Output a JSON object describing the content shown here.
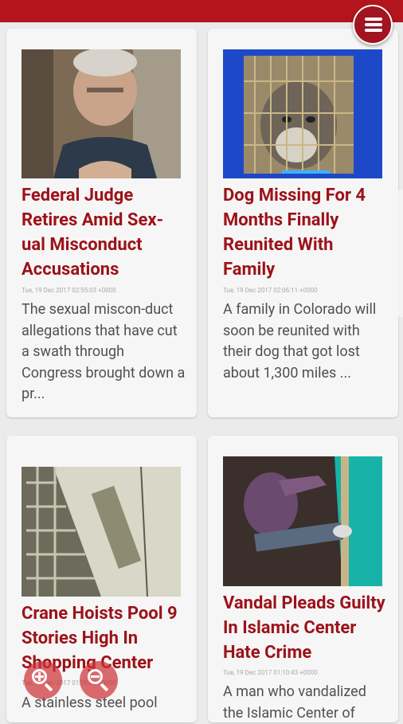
{
  "app": {
    "menu_icon": "hamburger-menu-icon",
    "accent_color": "#b3141d"
  },
  "articles": [
    {
      "title": "Federal Judge Retires Amid Sex-ual Misconduct Accusations",
      "date": "Tue, 19 Dec 2017 02:55:03 +0000",
      "description": "The sexual miscon-duct allegations that have cut a swath through Congress brought down a pr..."
    },
    {
      "title": "Dog Missing For 4 Months Finally Reunited With Family",
      "date": "Tue, 19 Dec 2017 02:06:11 +0000",
      "description": "A family in Colorado will soon be reunited with their dog that got lost about 1,300 miles ..."
    },
    {
      "title": "Crane Hoists Pool 9 Stories High In Shopping Center",
      "date": "Tue, 19 Dec 2017 01:20:45 +0000",
      "description": "A stainless steel pool"
    },
    {
      "title": "Vandal Pleads Guilty In Islamic Center Hate Crime",
      "date": "Tue, 19 Dec 2017 01:10:43 +0000",
      "description": "A man who vandalized the Islamic Center of"
    }
  ],
  "zoom_controls": {
    "zoom_in_icon": "zoom-in-icon",
    "zoom_out_icon": "zoom-out-icon"
  }
}
